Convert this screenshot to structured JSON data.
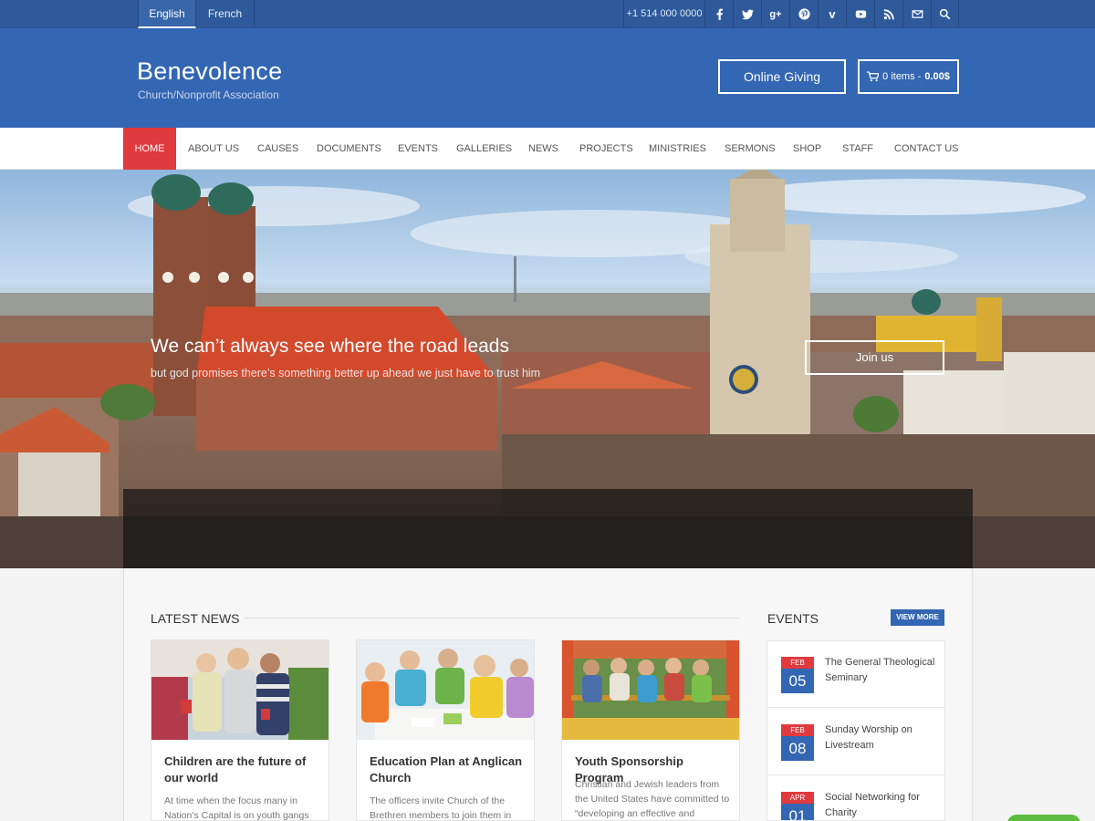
{
  "topbar": {
    "languages": [
      {
        "label": "English",
        "active": true
      },
      {
        "label": "French",
        "active": false
      }
    ],
    "phone": "+1 514 000 0000",
    "social_icons": [
      "facebook-icon",
      "twitter-icon",
      "google-plus-icon",
      "pinterest-icon",
      "vimeo-icon",
      "youtube-icon",
      "rss-icon",
      "mail-icon",
      "search-icon"
    ]
  },
  "header": {
    "title": "Benevolence",
    "subtitle": "Church/Nonprofit Association",
    "giving_label": "Online Giving",
    "cart_items": "0 items -",
    "cart_total": "0.00$"
  },
  "nav": {
    "items": [
      "HOME",
      "ABOUT US",
      "CAUSES",
      "DOCUMENTS",
      "EVENTS",
      "GALLERIES",
      "NEWS",
      "PROJECTS",
      "MINISTRIES",
      "SERMONS",
      "SHOP",
      "STAFF",
      "CONTACT US"
    ],
    "active": "HOME"
  },
  "hero": {
    "title": "We can’t always see where the road leads",
    "subtitle": "but god promises there’s something better up ahead we just have to trust him",
    "button": "Join us"
  },
  "news": {
    "heading": "LATEST NEWS",
    "items": [
      {
        "title": "Children are the future of our world",
        "excerpt": "At time when the focus many in Nation’s Capital is on youth gangs"
      },
      {
        "title": "Education Plan at Anglican Church",
        "excerpt": "The officers invite Church of the Brethren members to join them in"
      },
      {
        "title": "Youth Sponsorship Program",
        "excerpt": "Christian and Jewish leaders from the United States have committed to “developing an effective and"
      }
    ]
  },
  "events": {
    "heading": "EVENTS",
    "view_more": "VIEW MORE",
    "items": [
      {
        "month": "FEB",
        "day": "05",
        "title": "The General Theological Seminary"
      },
      {
        "month": "FEB",
        "day": "08",
        "title": "Sunday Worship on Livestream"
      },
      {
        "month": "APR",
        "day": "01",
        "title": "Social Networking for Charity"
      }
    ]
  },
  "colors": {
    "primary_blue": "#3366b3",
    "accent_red": "#e03a3e",
    "topbar_blue": "#2e5a9c"
  }
}
